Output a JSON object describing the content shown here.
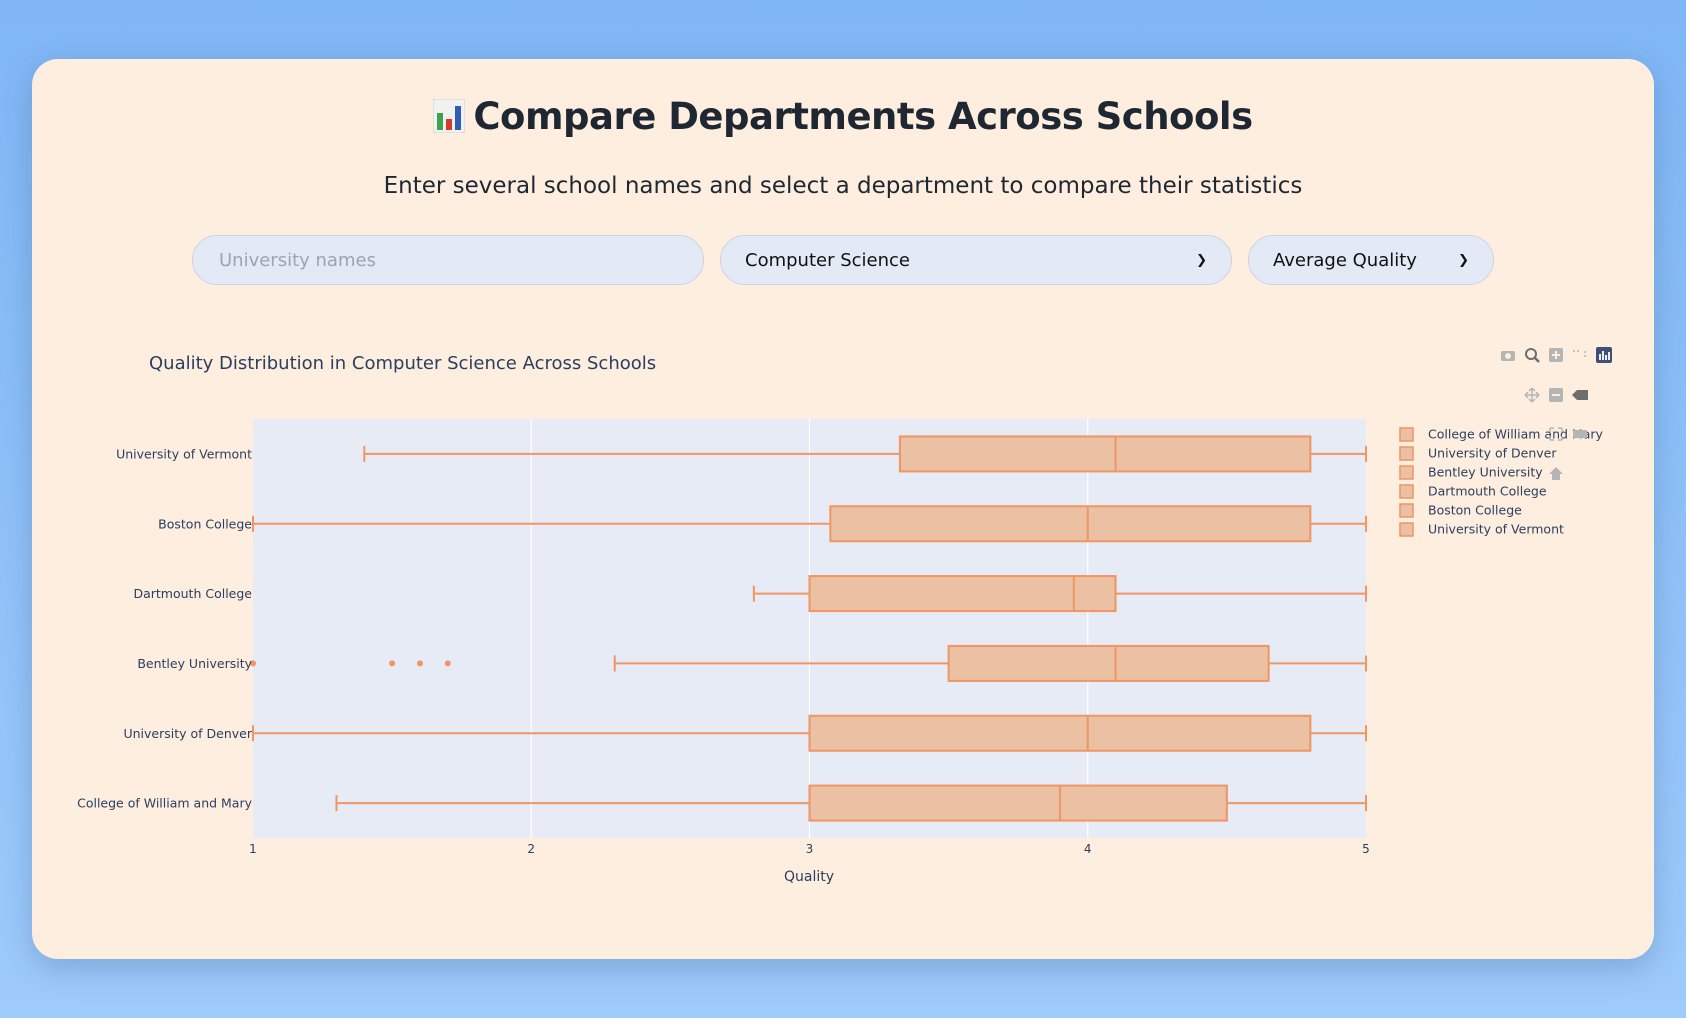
{
  "header": {
    "title_icon": "bar-chart-icon",
    "title": "Compare Departments Across Schools",
    "subtitle": "Enter several school names and select a department to compare their statistics"
  },
  "controls": {
    "school_input": {
      "value": "",
      "placeholder": "University names"
    },
    "department_select": {
      "selected": "Computer Science"
    },
    "metric_select": {
      "selected": "Average Quality"
    }
  },
  "modebar": {
    "icons": [
      "camera-icon",
      "zoom-icon",
      "zoom-in-icon",
      "select-icon",
      "plotly-logo-icon",
      "pan-icon",
      "zoom-out-icon",
      "lasso-icon",
      "autoscale-icon",
      "reset-icon",
      "home-icon"
    ]
  },
  "colors": {
    "box_fill": "#ecc0a2",
    "box_line": "#ef9662",
    "plot_bg": "#e6ebf6"
  },
  "chart_data": {
    "type": "box",
    "orientation": "horizontal",
    "title": "Quality Distribution in Computer Science Across Schools",
    "xlabel": "Quality",
    "ylabel": "",
    "xlim": [
      1,
      5
    ],
    "xticks": [
      1,
      2,
      3,
      4,
      5
    ],
    "grid": true,
    "legend_position": "right",
    "categories": [
      "College of William and Mary",
      "University of Denver",
      "Bentley University",
      "Dartmouth College",
      "Boston College",
      "University of Vermont"
    ],
    "series": [
      {
        "name": "College of William and Mary",
        "whisker_low": 1.3,
        "q1": 3.0,
        "median": 3.9,
        "q3": 4.5,
        "whisker_high": 5.0,
        "outliers": []
      },
      {
        "name": "University of Denver",
        "whisker_low": 1.0,
        "q1": 3.0,
        "median": 4.0,
        "q3": 4.8,
        "whisker_high": 5.0,
        "outliers": []
      },
      {
        "name": "Bentley University",
        "whisker_low": 2.3,
        "q1": 3.5,
        "median": 4.1,
        "q3": 4.65,
        "whisker_high": 5.0,
        "outliers": [
          1.0,
          1.5,
          1.6,
          1.7
        ]
      },
      {
        "name": "Dartmouth College",
        "whisker_low": 2.8,
        "q1": 3.0,
        "median": 3.95,
        "q3": 4.1,
        "whisker_high": 5.0,
        "outliers": []
      },
      {
        "name": "Boston College",
        "whisker_low": 1.0,
        "q1": 3.075,
        "median": 4.0,
        "q3": 4.8,
        "whisker_high": 5.0,
        "outliers": []
      },
      {
        "name": "University of Vermont",
        "whisker_low": 1.4,
        "q1": 3.325,
        "median": 4.1,
        "q3": 4.8,
        "whisker_high": 5.0,
        "outliers": []
      }
    ]
  }
}
